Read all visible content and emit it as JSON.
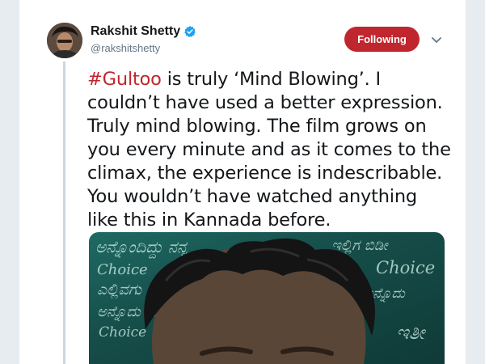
{
  "tweet": {
    "author_name": "Rakshit Shetty",
    "author_handle": "@rakshitshetty",
    "verified": true,
    "follow_label": "Following",
    "hashtag": "#Gultoo",
    "body": " is truly ‘Mind Blowing’. I couldn’t have used a better expression. Truly mind blowing. The film grows on you every minute and as it comes to the climax, the experience is indescribable. You wouldn’t have watched anything like this in Kannada before."
  },
  "media": {
    "chalk_words": [
      "Choice",
      "Choice",
      "Choice"
    ]
  },
  "colors": {
    "accent": "#c0262d",
    "text": "#14171a",
    "muted": "#657786",
    "verified": "#1da1f2"
  },
  "icons": {
    "verified": "verified-badge-icon",
    "menu": "chevron-down-icon"
  }
}
